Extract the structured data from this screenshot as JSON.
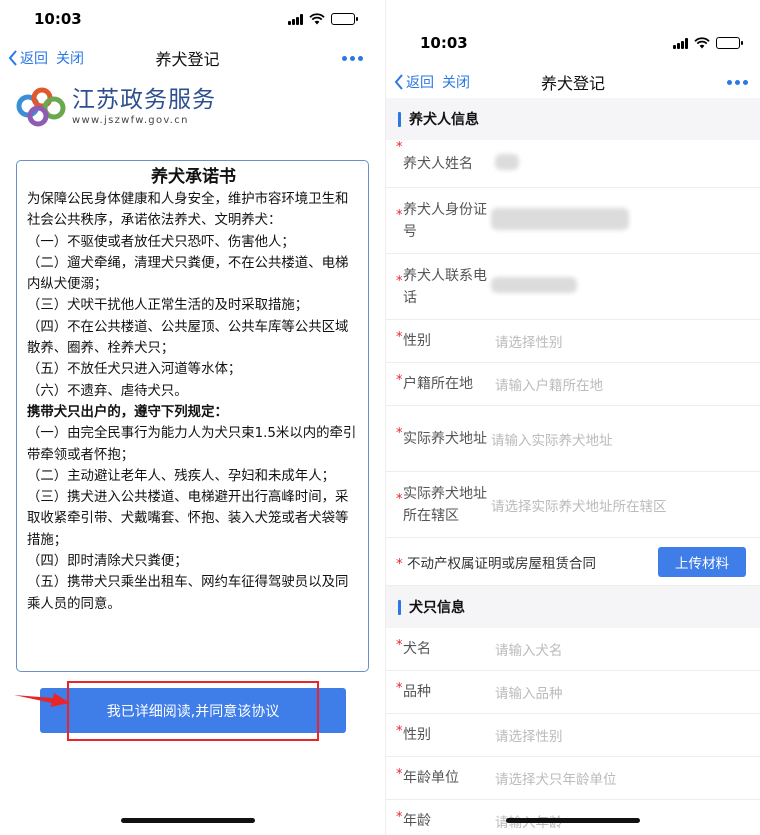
{
  "left": {
    "status": {
      "time": "10:03"
    },
    "nav": {
      "back": "返回",
      "close": "关闭",
      "title": "养犬登记"
    },
    "brand": {
      "name": "江苏政务服务",
      "url": "www.jszwfw.gov.cn"
    },
    "agreement": {
      "title": "养犬承诺书",
      "paragraphs": [
        "为保障公民身体健康和人身安全，维护市容环境卫生和社会公共秩序，承诺依法养犬、文明养犬：",
        "（一）不驱使或者放任犬只恐吓、伤害他人；",
        "（二）遛犬牵绳，清理犬只粪便，不在公共楼道、电梯内纵犬便溺；",
        "（三）犬吠干扰他人正常生活的及时采取措施；",
        "（四）不在公共楼道、公共屋顶、公共车库等公共区域散养、圈养、栓养犬只；",
        "（五）不放任犬只进入河道等水体；",
        "（六）不遗弃、虐待犬只。",
        "携带犬只出户的，遵守下列规定：",
        "（一）由完全民事行为能力人为犬只束1.5米以内的牵引带牵领或者怀抱；",
        "（二）主动避让老年人、残疾人、孕妇和未成年人；",
        "（三）携犬进入公共楼道、电梯避开出行高峰时间，采取收紧牵引带、犬戴嘴套、怀抱、装入犬笼或者犬袋等措施；",
        "（四）即时清除犬只粪便；",
        "（五）携带犬只乘坐出租车、网约车征得驾驶员以及同乘人员的同意。"
      ]
    },
    "agree_button": "我已详细阅读,并同意该协议"
  },
  "right": {
    "status": {
      "time": "10:03"
    },
    "nav": {
      "back": "返回",
      "close": "关闭",
      "title": "养犬登记"
    },
    "owner_section": "养犬人信息",
    "owner_fields": [
      {
        "label": "养犬人姓名",
        "required": "*",
        "placeholder": ""
      },
      {
        "label": "养犬人身份证号",
        "required": "*",
        "placeholder": ""
      },
      {
        "label": "养犬人联系电话",
        "required": "*",
        "placeholder": ""
      },
      {
        "label": "性别",
        "required": "*",
        "placeholder": "请选择性别"
      },
      {
        "label": "户籍所在地",
        "required": "*",
        "placeholder": "请输入户籍所在地"
      },
      {
        "label": "实际养犬地址",
        "required": "*",
        "placeholder": "请输入实际养犬地址"
      },
      {
        "label": "实际养犬地址所在辖区",
        "required": "*",
        "placeholder": "请选择实际养犬地址所在辖区"
      }
    ],
    "property_label": "不动产权属证明或房屋租赁合同",
    "property_required": "*",
    "upload_button": "上传材料",
    "dog_section": "犬只信息",
    "dog_fields": [
      {
        "label": "犬名",
        "required": "*",
        "placeholder": "请输入犬名"
      },
      {
        "label": "品种",
        "required": "*",
        "placeholder": "请输入品种"
      },
      {
        "label": "性别",
        "required": "*",
        "placeholder": "请选择性别"
      },
      {
        "label": "年龄单位",
        "required": "*",
        "placeholder": "请选择犬只年龄单位"
      },
      {
        "label": "年龄",
        "required": "*",
        "placeholder": "请输入年龄"
      }
    ]
  },
  "colors": {
    "accent": "#3f7de8",
    "highlight": "#e8262a",
    "brand": "#2d4f8f"
  },
  "icons": [
    "back-chevron-icon",
    "more-dots-icon",
    "signal-icon",
    "wifi-icon",
    "battery-icon",
    "jszwfw-logo-icon",
    "red-arrow-icon"
  ]
}
